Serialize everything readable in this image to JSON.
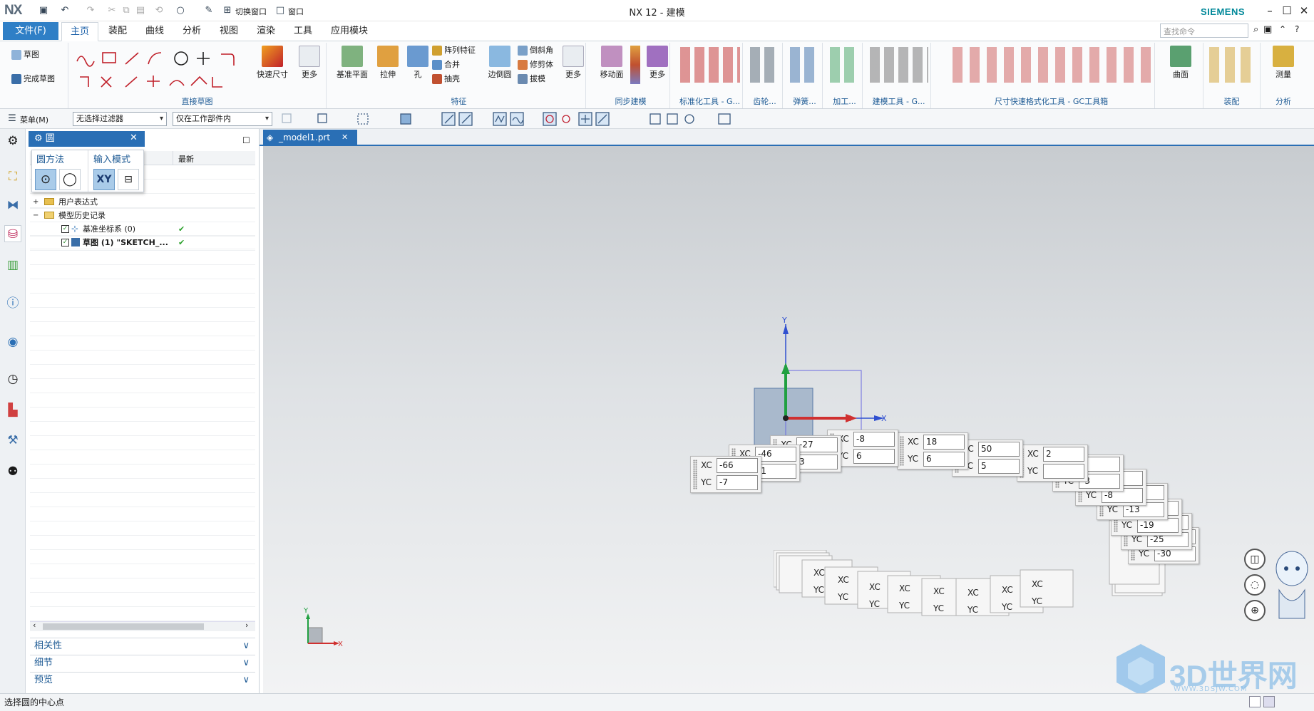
{
  "app": {
    "logo": "NX",
    "title": "NX 12 - 建模",
    "brand": "SIEMENS",
    "switch_window": "切换窗口",
    "window_menu": "窗口"
  },
  "tabs": {
    "file": "文件(F)",
    "items": [
      "主页",
      "装配",
      "曲线",
      "分析",
      "视图",
      "渲染",
      "工具",
      "应用模块"
    ],
    "active": "主页"
  },
  "search": {
    "placeholder": "查找命令"
  },
  "ribbon": {
    "sketch": {
      "sketch": "草图",
      "finish": "完成草图",
      "label": "直接草图",
      "dim": "快速尺寸",
      "more": "更多"
    },
    "feature": {
      "datum_plane": "基准平面",
      "extrude": "拉伸",
      "hole": "孔",
      "pattern": "阵列特征",
      "unite": "合并",
      "shell": "抽壳",
      "edge_blend": "边倒圆",
      "chamfer": "倒斜角",
      "trim": "修剪体",
      "draft": "拔模",
      "more": "更多",
      "label": "特征"
    },
    "sync": {
      "move_face": "移动面",
      "more": "更多",
      "label": "同步建模"
    },
    "groups": [
      "标准化工具 - G...",
      "齿轮...",
      "弹簧...",
      "加工...",
      "建模工具 - G...",
      "尺寸快速格式化工具 - GC工具箱"
    ],
    "surface": {
      "label": "曲面"
    },
    "assembly": {
      "label": "装配"
    },
    "analysis": {
      "measure": "测量",
      "label": "分析"
    }
  },
  "toolbar2": {
    "menu": "菜单(M)",
    "filter": "无选择过滤器",
    "scope": "仅在工作部件内"
  },
  "navigator": {
    "title": "圆",
    "col_latest": "最新",
    "popup": {
      "method_label": "圆方法",
      "input_label": "输入模式",
      "xy": "XY"
    },
    "rows": [
      {
        "label": "用户表达式",
        "check": ""
      },
      {
        "label": "模型历史记录",
        "check": ""
      },
      {
        "label": "基准坐标系 (0)",
        "check": "✔"
      },
      {
        "label": "草图 (1) \"SKETCH_...",
        "check": "✔"
      }
    ],
    "folds": [
      "相关性",
      "细节",
      "预览"
    ]
  },
  "doc_tab": "_model1.prt",
  "axes": {
    "x": "X",
    "y": "Y",
    "xc": "XC",
    "yc": "YC"
  },
  "dyn_boxes": [
    {
      "xc": "-66",
      "yc": "-7"
    },
    {
      "xc": "-46",
      "yc": "-1"
    },
    {
      "xc": "-27",
      "yc": "3"
    },
    {
      "xc": "-8",
      "yc": "6"
    },
    {
      "xc": "18",
      "yc": "6"
    },
    {
      "xc": "50",
      "yc": "5"
    },
    {
      "xc": "2",
      "yc": ""
    },
    {
      "xc": "0",
      "yc": "-3"
    },
    {
      "xc": "3",
      "yc": "-8"
    },
    {
      "xc": "",
      "yc": "-13"
    },
    {
      "xc": "",
      "yc": "-19"
    },
    {
      "xc": "",
      "yc": "-25"
    },
    {
      "xc": "",
      "yc": "-30"
    }
  ],
  "status": "选择圆的中心点",
  "watermark": {
    "text": "3D世界网",
    "url": "WWW.3DSJW.COM"
  }
}
